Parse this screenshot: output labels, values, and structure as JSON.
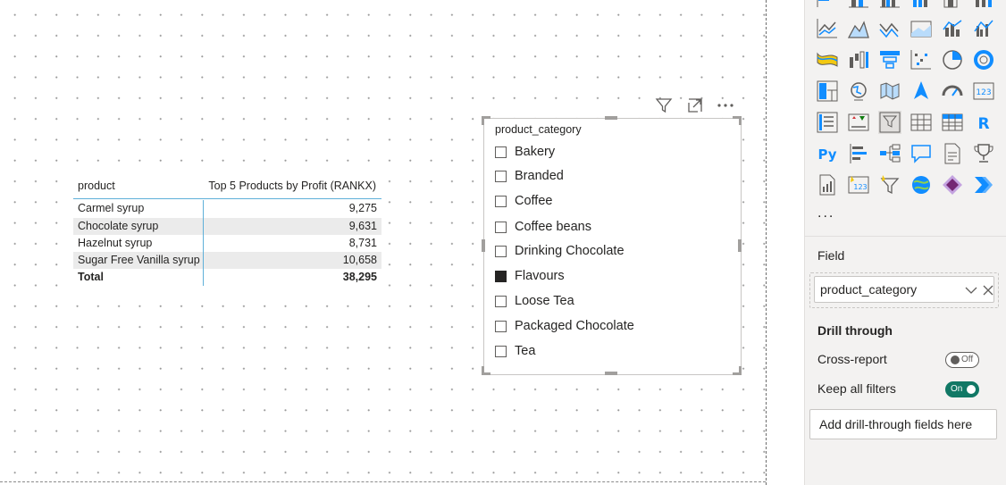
{
  "table": {
    "headers": [
      "product",
      "Top 5 Products by Profit (RANKX)"
    ],
    "rows": [
      {
        "product": "Carmel syrup",
        "value": "9,275"
      },
      {
        "product": "Chocolate syrup",
        "value": "9,631"
      },
      {
        "product": "Hazelnut syrup",
        "value": "8,731"
      },
      {
        "product": "Sugar Free Vanilla syrup",
        "value": "10,658"
      }
    ],
    "total": {
      "label": "Total",
      "value": "38,295"
    }
  },
  "slicer": {
    "title": "product_category",
    "items": [
      {
        "label": "Bakery",
        "checked": false
      },
      {
        "label": "Branded",
        "checked": false
      },
      {
        "label": "Coffee",
        "checked": false
      },
      {
        "label": "Coffee beans",
        "checked": false
      },
      {
        "label": "Drinking Chocolate",
        "checked": false
      },
      {
        "label": "Flavours",
        "checked": true
      },
      {
        "label": "Loose Tea",
        "checked": false
      },
      {
        "label": "Packaged Chocolate",
        "checked": false
      },
      {
        "label": "Tea",
        "checked": false
      }
    ],
    "toolbar_icons": [
      "filter-icon",
      "focus-mode-icon",
      "more-options-icon"
    ]
  },
  "pane": {
    "visual_icons": [
      "stacked-bar-chart-icon",
      "stacked-column-chart-icon",
      "clustered-column-chart-icon",
      "clustered-bar-chart-icon",
      "100-percent-bar-chart-icon",
      "100-percent-column-chart-icon",
      "line-chart-icon",
      "area-chart-icon",
      "stacked-area-chart-icon",
      "100-percent-area-chart-icon",
      "line-and-column-chart-icon",
      "line-and-clustered-column-chart-icon",
      "ribbon-chart-icon",
      "waterfall-chart-icon",
      "funnel-chart-icon",
      "scatter-chart-icon",
      "pie-chart-icon",
      "donut-chart-icon",
      "treemap-icon",
      "map-icon",
      "filled-map-icon",
      "azure-map-icon",
      "gauge-icon",
      "card-icon",
      "multi-row-card-icon",
      "kpi-icon",
      "slicer-icon",
      "table-icon",
      "matrix-icon",
      "r-visual-icon",
      "python-visual-icon",
      "key-influencers-icon",
      "decomposition-tree-icon",
      "qa-icon",
      "smart-narrative-icon",
      "metrics-icon",
      "paginated-report-icon",
      "new-card-icon",
      "new-slicer-icon",
      "arcgis-map-icon",
      "power-apps-icon",
      "power-automate-icon"
    ],
    "more_visuals": "...",
    "field_label": "Field",
    "field_value": "product_category",
    "drill_through_label": "Drill through",
    "cross_report_label": "Cross-report",
    "cross_report_state": "Off",
    "keep_filters_label": "Keep all filters",
    "keep_filters_state": "On",
    "add_drillthrough": "Add drill-through fields here",
    "accent_color": "#117865"
  }
}
